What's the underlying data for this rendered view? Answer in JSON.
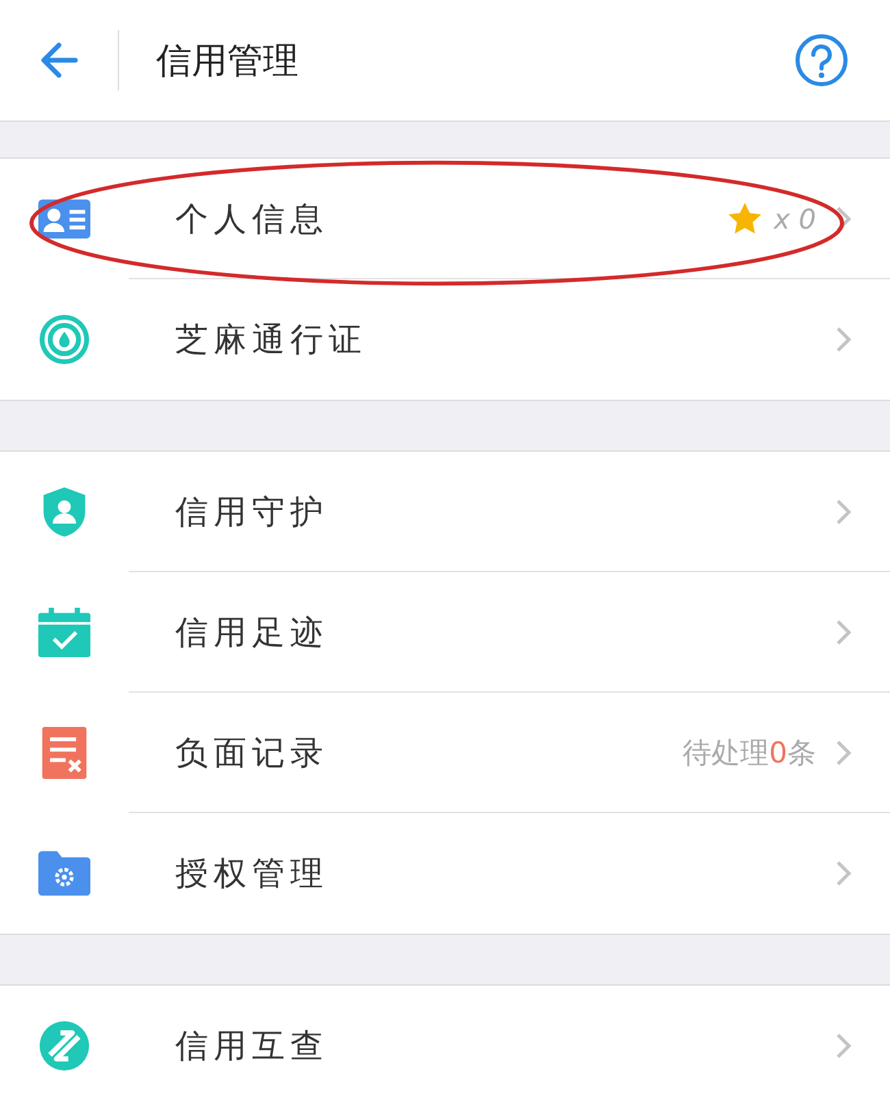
{
  "header": {
    "title": "信用管理"
  },
  "groups": [
    {
      "items": [
        {
          "kind": "id-card",
          "label": "个人信息",
          "highlighted": true,
          "reward": "x 0"
        },
        {
          "kind": "pass",
          "label": "芝麻通行证",
          "highlighted": false
        }
      ]
    },
    {
      "items": [
        {
          "kind": "shield",
          "label": "信用守护",
          "highlighted": false
        },
        {
          "kind": "calendar",
          "label": "信用足迹",
          "highlighted": false
        },
        {
          "kind": "record",
          "label": "负面记录",
          "highlighted": false,
          "pending": {
            "prefix": "待处理",
            "count": "0",
            "suffix": "条"
          }
        },
        {
          "kind": "folder",
          "label": "授权管理",
          "highlighted": false
        }
      ]
    },
    {
      "items": [
        {
          "kind": "swap",
          "label": "信用互查",
          "highlighted": false
        }
      ]
    }
  ]
}
